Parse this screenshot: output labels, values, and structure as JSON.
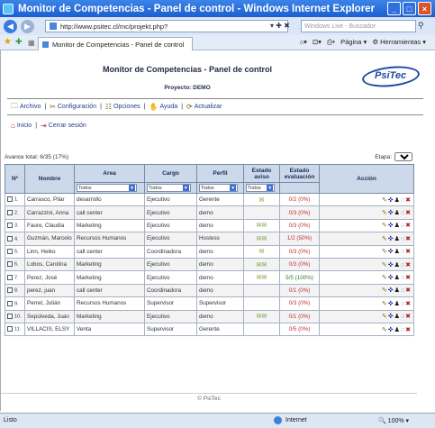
{
  "window": {
    "title": "Monitor de Competencias - Panel de control - Windows Internet Explorer"
  },
  "browser": {
    "url": "http://www.psitec.cl/mc/projekt.php?",
    "search_placeholder": "Windows Live - Buscador",
    "tab_title": "Monitor de Competencias - Panel de control",
    "tool_page": "Página",
    "tool_tools": "Herramientas"
  },
  "page": {
    "title": "Monitor de Competencias - Panel de control",
    "project": "Proyecto: DEMO",
    "logo": "PsiTec",
    "menu": [
      "Archivo",
      "Configuración",
      "Opciones",
      "Ayuda",
      "Actualizar"
    ],
    "sub": [
      "Inicio",
      "Cerrar sesión"
    ],
    "progress": "Avance total: 6/35 (17%)",
    "etapa_label": "Etapa:",
    "etapa_value": "T1",
    "columns": [
      "Nº",
      "Nombre",
      "Area",
      "Cargo",
      "Perfil",
      "Estado aviso",
      "Estado evaluación",
      "Acción"
    ],
    "filter_default": "Todos",
    "rows": [
      {
        "n": "1.",
        "nombre": "Carrasco, Pilar",
        "area": "desarrollo",
        "cargo": "Ejecutivo",
        "perfil": "Gerente",
        "aviso": "✉",
        "eval": "0/2 (0%)",
        "ok": false
      },
      {
        "n": "2.",
        "nombre": "Carrazzini, Anna",
        "area": "call center",
        "cargo": "Ejecutivo",
        "perfil": "demo",
        "aviso": "",
        "eval": "0/3 (0%)",
        "ok": false
      },
      {
        "n": "3.",
        "nombre": "Faure, Claudia",
        "area": "Marketing",
        "cargo": "Ejecutivo",
        "perfil": "demo",
        "aviso": "✉✉",
        "eval": "0/3 (0%)",
        "ok": false
      },
      {
        "n": "4.",
        "nombre": "Guzmán, Marcelo",
        "area": "Recursos Humanos",
        "cargo": "Ejecutivo",
        "perfil": "Hostess",
        "aviso": "✉✉",
        "eval": "1/2 (50%)",
        "ok": false
      },
      {
        "n": "5.",
        "nombre": "Linn, Heiko",
        "area": "call center",
        "cargo": "Coordinadora",
        "perfil": "demo",
        "aviso": "✉",
        "eval": "0/3 (0%)",
        "ok": false
      },
      {
        "n": "6.",
        "nombre": "Lobos, Carolina",
        "area": "Marketing",
        "cargo": "Ejecutivo",
        "perfil": "demo",
        "aviso": "✉✉",
        "eval": "0/3 (0%)",
        "ok": false
      },
      {
        "n": "7.",
        "nombre": "Perez, José",
        "area": "Marketing",
        "cargo": "Ejecutivo",
        "perfil": "demo",
        "aviso": "✉✉",
        "eval": "5/5 (100%)",
        "ok": true
      },
      {
        "n": "8.",
        "nombre": "perez, juan",
        "area": "call center",
        "cargo": "Coordinadora",
        "perfil": "demo",
        "aviso": "",
        "eval": "0/1 (0%)",
        "ok": false
      },
      {
        "n": "9.",
        "nombre": "Perret, Julián",
        "area": "Recursos Humanos",
        "cargo": "Supervisor",
        "perfil": "Supervisor",
        "aviso": "",
        "eval": "0/3 (0%)",
        "ok": false
      },
      {
        "n": "10.",
        "nombre": "Sepúlveda, Juan",
        "area": "Marketing",
        "cargo": "Ejecutivo",
        "perfil": "demo",
        "aviso": "✉✉",
        "eval": "0/1 (0%)",
        "ok": false
      },
      {
        "n": "11.",
        "nombre": "VILLACIS, ELSY",
        "area": "Venta",
        "cargo": "Supervisor",
        "perfil": "Gerente",
        "aviso": "",
        "eval": "0/5 (0%)",
        "ok": false
      }
    ],
    "footer": "© PsiTec"
  },
  "status": {
    "left": "Listo",
    "zone": "Internet",
    "zoom": "100%"
  }
}
